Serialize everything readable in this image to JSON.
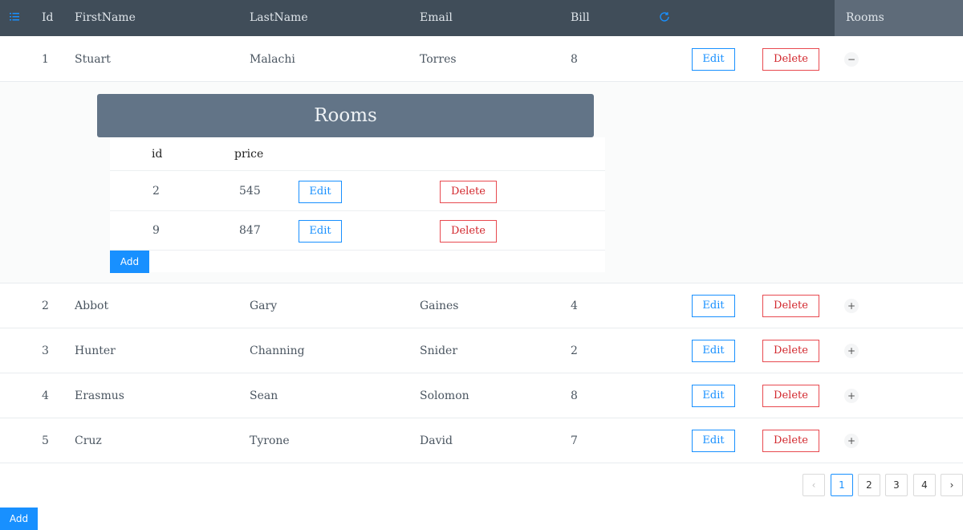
{
  "header": {
    "id": "Id",
    "first_name": "FirstName",
    "last_name": "LastName",
    "email": "Email",
    "bill": "Bill",
    "rooms": "Rooms"
  },
  "rows": [
    {
      "id": "1",
      "first": "Stuart",
      "last": "Malachi",
      "email": "Torres",
      "bill": "8",
      "edit": "Edit",
      "delete": "Delete",
      "toggle": "−"
    },
    {
      "id": "2",
      "first": "Abbot",
      "last": "Gary",
      "email": "Gaines",
      "bill": "4",
      "edit": "Edit",
      "delete": "Delete",
      "toggle": "+"
    },
    {
      "id": "3",
      "first": "Hunter",
      "last": "Channing",
      "email": "Snider",
      "bill": "2",
      "edit": "Edit",
      "delete": "Delete",
      "toggle": "+"
    },
    {
      "id": "4",
      "first": "Erasmus",
      "last": "Sean",
      "email": "Solomon",
      "bill": "8",
      "edit": "Edit",
      "delete": "Delete",
      "toggle": "+"
    },
    {
      "id": "5",
      "first": "Cruz",
      "last": "Tyrone",
      "email": "David",
      "bill": "7",
      "edit": "Edit",
      "delete": "Delete",
      "toggle": "+"
    }
  ],
  "rooms_panel": {
    "title": "Rooms",
    "col_id": "id",
    "col_price": "price",
    "rows": [
      {
        "id": "2",
        "price": "545",
        "edit": "Edit",
        "delete": "Delete"
      },
      {
        "id": "9",
        "price": "847",
        "edit": "Edit",
        "delete": "Delete"
      }
    ],
    "add": "Add"
  },
  "pagination": {
    "prev": "‹",
    "pages": [
      "1",
      "2",
      "3",
      "4"
    ],
    "current": "1",
    "next": "›"
  },
  "add_button": "Add",
  "colors": {
    "header_bg": "#404d59",
    "accent": "#1890ff",
    "danger": "#e84a50"
  }
}
